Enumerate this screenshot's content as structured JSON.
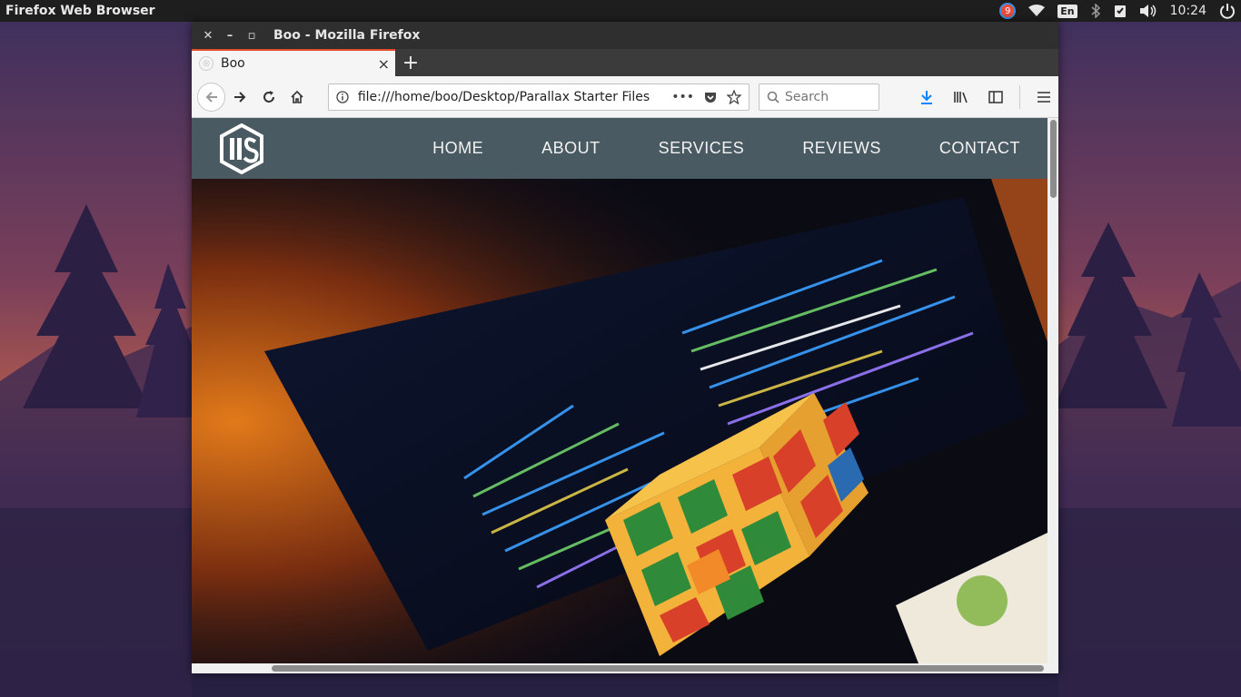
{
  "top_panel": {
    "app_name": "Firefox Web Browser",
    "notification_count": "9",
    "keyboard_layout": "En",
    "clock": "10:24"
  },
  "window": {
    "title": "Boo - Mozilla Firefox",
    "tab": {
      "label": "Boo",
      "close": "×"
    },
    "new_tab": "+",
    "url": "file:///home/boo/Desktop/Parallax Starter Files",
    "search_placeholder": "Search"
  },
  "site": {
    "menu": [
      "HOME",
      "ABOUT",
      "SERVICES",
      "REVIEWS",
      "CONTACT"
    ]
  },
  "colors": {
    "site_nav": "#4a5a63",
    "tab_accent": "#e44d2a",
    "download_icon": "#0a84ff"
  }
}
